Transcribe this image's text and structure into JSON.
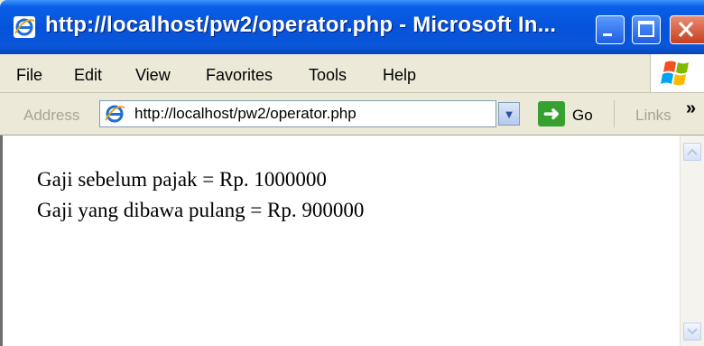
{
  "window": {
    "title": "http://localhost/pw2/operator.php - Microsoft In...",
    "icons": {
      "app": "internet-explorer-icon",
      "minimize": "minimize-icon",
      "maximize": "maximize-icon",
      "close": "close-icon",
      "brand": "windows-logo-icon"
    },
    "colors": {
      "titlebar": "#0553DB",
      "close": "#C4401F",
      "go": "#35A12E"
    }
  },
  "menu": {
    "items": [
      "File",
      "Edit",
      "View",
      "Favorites",
      "Tools",
      "Help"
    ]
  },
  "address": {
    "label": "Address",
    "url": "http://localhost/pw2/operator.php",
    "go_label": "Go",
    "links_label": "Links",
    "more": "»"
  },
  "content": {
    "lines": [
      "Gaji sebelum pajak = Rp. 1000000",
      "Gaji yang dibawa pulang = Rp. 900000"
    ]
  }
}
